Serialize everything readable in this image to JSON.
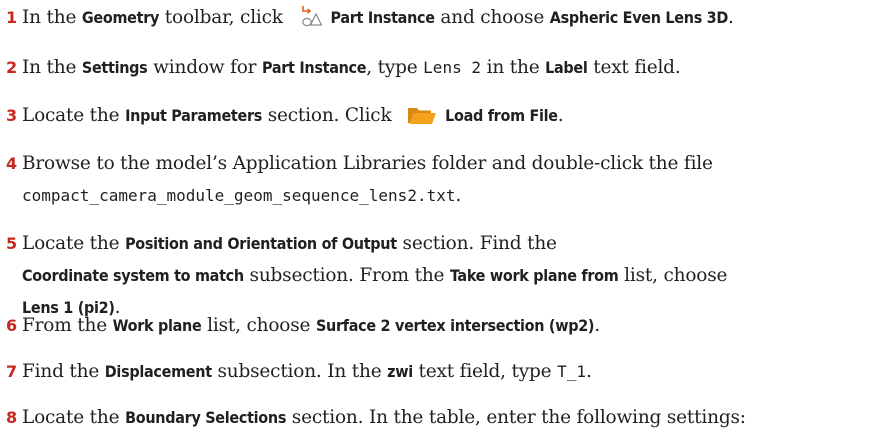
{
  "steps": [
    {
      "number": "1",
      "t1": "In the ",
      "b1": "Geometry",
      "t2": " toolbar, click ",
      "icon": "part-instance-icon",
      "b2": "Part Instance",
      "t3": " and choose ",
      "b3": "Aspheric Even Lens 3D",
      "t4": "."
    },
    {
      "number": "2",
      "t1": "In the ",
      "b1": "Settings",
      "t2": " window for ",
      "b2": "Part Instance",
      "t3": ", type ",
      "c1": "Lens 2",
      "t4": " in the ",
      "b3": "Label",
      "t5": " text field."
    },
    {
      "number": "3",
      "t1": "Locate the ",
      "b1": "Input Parameters",
      "t2": " section. Click ",
      "icon": "folder-icon",
      "b2": "Load from File",
      "t3": "."
    },
    {
      "number": "4",
      "t1": "Browse to the model’s Application Libraries folder and double-click the file",
      "c1": "compact_camera_module_geom_sequence_lens2.txt",
      "t2": "."
    },
    {
      "number": "5",
      "t1": "Locate the ",
      "b1": "Position and Orientation of Output",
      "t2": " section. Find the",
      "b2": "Coordinate system to match",
      "t3": " subsection. From the ",
      "b3": "Take work plane from",
      "t4": " list, choose",
      "b4": "Lens 1 (pi2)",
      "t5": "."
    },
    {
      "number": "6",
      "t1": "From the ",
      "b1": "Work plane",
      "t2": " list, choose ",
      "b2": "Surface 2 vertex intersection (wp2)",
      "t3": "."
    },
    {
      "number": "7",
      "t1": "Find the ",
      "b1": "Displacement",
      "t2": " subsection. In the ",
      "b2": "zwi",
      "t3": " text field, type ",
      "c1": "T_1",
      "t4": "."
    },
    {
      "number": "8",
      "t1": "Locate the ",
      "b1": "Boundary Selections",
      "t2": " section. In the table, enter the following settings:"
    }
  ],
  "colors": {
    "step_number": "#c8281e",
    "text": "#231f20",
    "folder_icon": "#f4a21c",
    "part_icon_arrow": "#e0611b"
  }
}
